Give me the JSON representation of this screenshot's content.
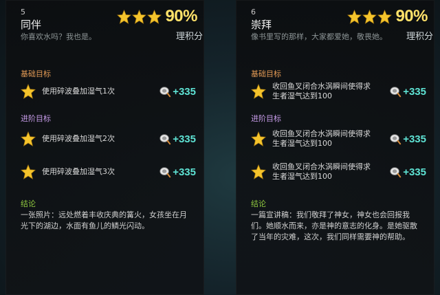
{
  "colors": {
    "star": "#f5c42c",
    "percent": "#ffe26a",
    "reward": "#5ee3d4",
    "basic_heading": "#e39a55",
    "advanced_heading": "#c69be8",
    "conclusion_heading": "#8ec63f"
  },
  "icons": {
    "rating_star": "star-icon",
    "goal_star": "star-icon",
    "reward": "shell-icon"
  },
  "cards": [
    {
      "number": "5",
      "title": "同伴",
      "description": "你喜欢水吗？我也是。",
      "stars": 3,
      "percent": "90%",
      "suffix": "理积分",
      "basic_heading": "基础目标",
      "basic_goals": [
        {
          "text": "使用碎波叠加湿气1次",
          "reward": "+335"
        }
      ],
      "advanced_heading": "进阶目标",
      "advanced_goals": [
        {
          "text": "使用碎波叠加湿气2次",
          "reward": "+335"
        },
        {
          "text": "使用碎波叠加湿气3次",
          "reward": "+335"
        }
      ],
      "conclusion_heading": "结论",
      "conclusion_text": "一张照片：远处燃着丰收庆典的篝火，女孩坐在月光下的湖边，水面有鱼儿的鳞光闪动。"
    },
    {
      "number": "6",
      "title": "崇拜",
      "description": "像书里写的那样，大家都爱她，敬畏她。",
      "stars": 3,
      "percent": "90%",
      "suffix": "理积分",
      "basic_heading": "基础目标",
      "basic_goals": [
        {
          "text": "收回鱼叉闭合水涡瞬间使得求生者湿气达到100",
          "reward": "+335"
        }
      ],
      "advanced_heading": "进阶目标",
      "advanced_goals": [
        {
          "text": "收回鱼叉闭合水涡瞬间使得求生者湿气达到100",
          "reward": "+335"
        },
        {
          "text": "收回鱼叉闭合水涡瞬间使得求生者湿气达到100",
          "reward": "+335"
        }
      ],
      "conclusion_heading": "结论",
      "conclusion_text": "一篇宣讲稿：我们敬拜了神女，神女也会回报我们。她顺水而来，亦是神的意志的化身。是她驱散了当年的灾难，这次，我们同样需要神的帮助。"
    }
  ]
}
